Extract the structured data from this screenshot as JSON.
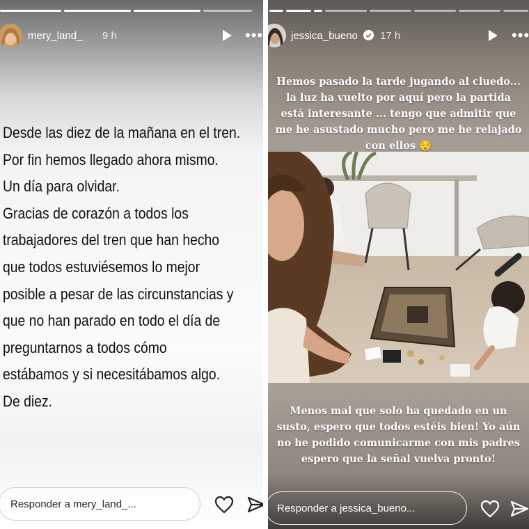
{
  "left_story": {
    "username": "mery_land_",
    "time": "9 h",
    "caption_lines": [
      "Desde las diez de la mañana en el tren.",
      "Por fin hemos llegado ahora mismo.",
      "Un día para olvidar.",
      "Gracias de corazón a todos los",
      "trabajadores del tren que han hecho",
      "que todos estuviésemos lo mejor",
      "posible a pesar de las circunstancias y",
      "que no han parado en todo el día de",
      "preguntarnos a todos cómo",
      "estábamos y si necesitábamos algo.",
      "De diez."
    ],
    "reply_placeholder": "Responder a mery_land_..."
  },
  "right_story": {
    "username": "jessica_bueno",
    "verified": true,
    "time": "17 h",
    "top_text_lines": [
      "Hemos pasado la tarde jugando al cluedo...",
      "la luz ha vuelto por aquí pero la partida",
      "está interesante ... tengo que admitir que",
      "me he asustado mucho pero me he relajado",
      "con ellos 😌"
    ],
    "bottom_text_lines": [
      "Menos mal que solo ha quedado en un",
      "susto, espero que todos estéis bien! Yo aún",
      "no he podido comunicarme con mis padres",
      "espero que la señal vuelva pronto!"
    ],
    "reply_placeholder": "Responder a jessica_bueno..."
  },
  "icons": {
    "play": "play-icon",
    "more": "more-icon",
    "heart": "heart-icon",
    "send": "send-icon",
    "verified": "verified-badge-icon"
  },
  "colors": {
    "verified_badge": "#ffffff",
    "overlay_text": "#ffffff",
    "caption_text": "#111111"
  }
}
